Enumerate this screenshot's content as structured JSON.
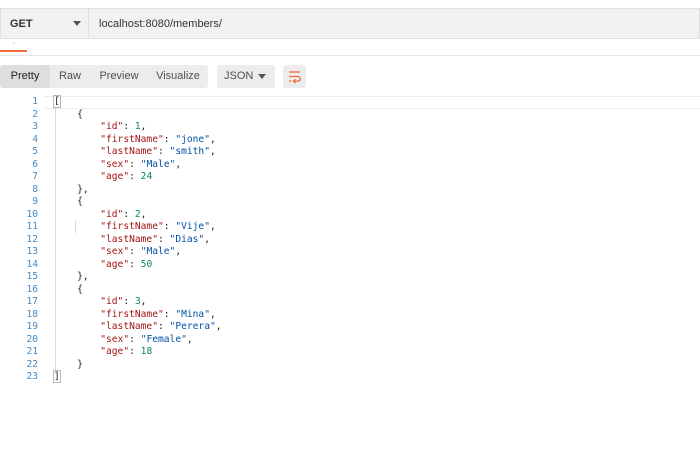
{
  "request": {
    "method": "GET",
    "url": "localhost:8080/members/"
  },
  "response_toolbar": {
    "tabs": [
      {
        "label": "Pretty",
        "active": true
      },
      {
        "label": "Raw",
        "active": false
      },
      {
        "label": "Preview",
        "active": false
      },
      {
        "label": "Visualize",
        "active": false
      }
    ],
    "format": "JSON",
    "wrap_icon": "wrap-lines-icon"
  },
  "colors": {
    "accent": "#f26b3a",
    "json_key": "#a31515",
    "json_string": "#0451a5",
    "json_number": "#098658",
    "line_number": "#4a8ac0"
  },
  "body": {
    "lines": [
      "[",
      "    {",
      "        \"id\": 1,",
      "        \"firstName\": \"jone\",",
      "        \"lastName\": \"smith\",",
      "        \"sex\": \"Male\",",
      "        \"age\": 24",
      "    },",
      "    {",
      "        \"id\": 2,",
      "        \"firstName\": \"Vije\",",
      "        \"lastName\": \"Dias\",",
      "        \"sex\": \"Male\",",
      "        \"age\": 50",
      "    },",
      "    {",
      "        \"id\": 3,",
      "        \"firstName\": \"Mina\",",
      "        \"lastName\": \"Perera\",",
      "        \"sex\": \"Female\",",
      "        \"age\": 18",
      "    }",
      "]"
    ]
  }
}
